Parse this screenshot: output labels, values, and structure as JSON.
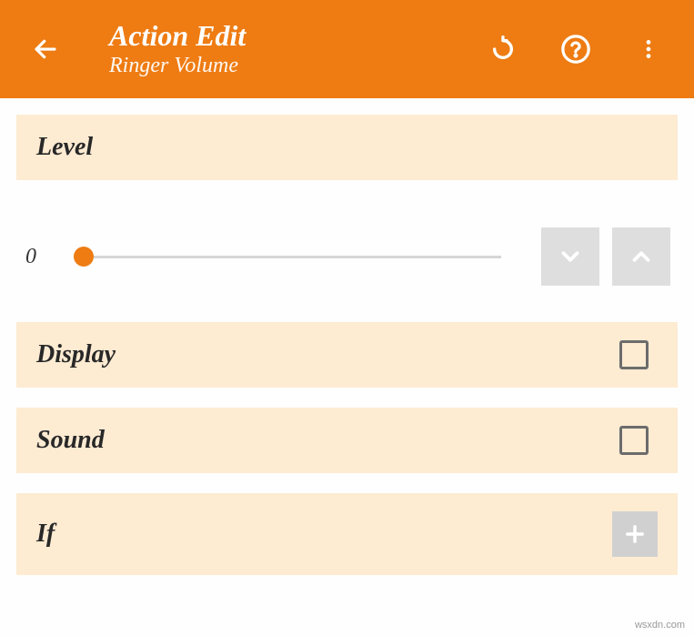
{
  "header": {
    "title": "Action Edit",
    "subtitle": "Ringer Volume"
  },
  "sections": {
    "level": {
      "label": "Level",
      "value": "0"
    },
    "display": {
      "label": "Display",
      "checked": false
    },
    "sound": {
      "label": "Sound",
      "checked": false
    },
    "condition": {
      "label": "If"
    }
  },
  "watermark": "wsxdn.com"
}
